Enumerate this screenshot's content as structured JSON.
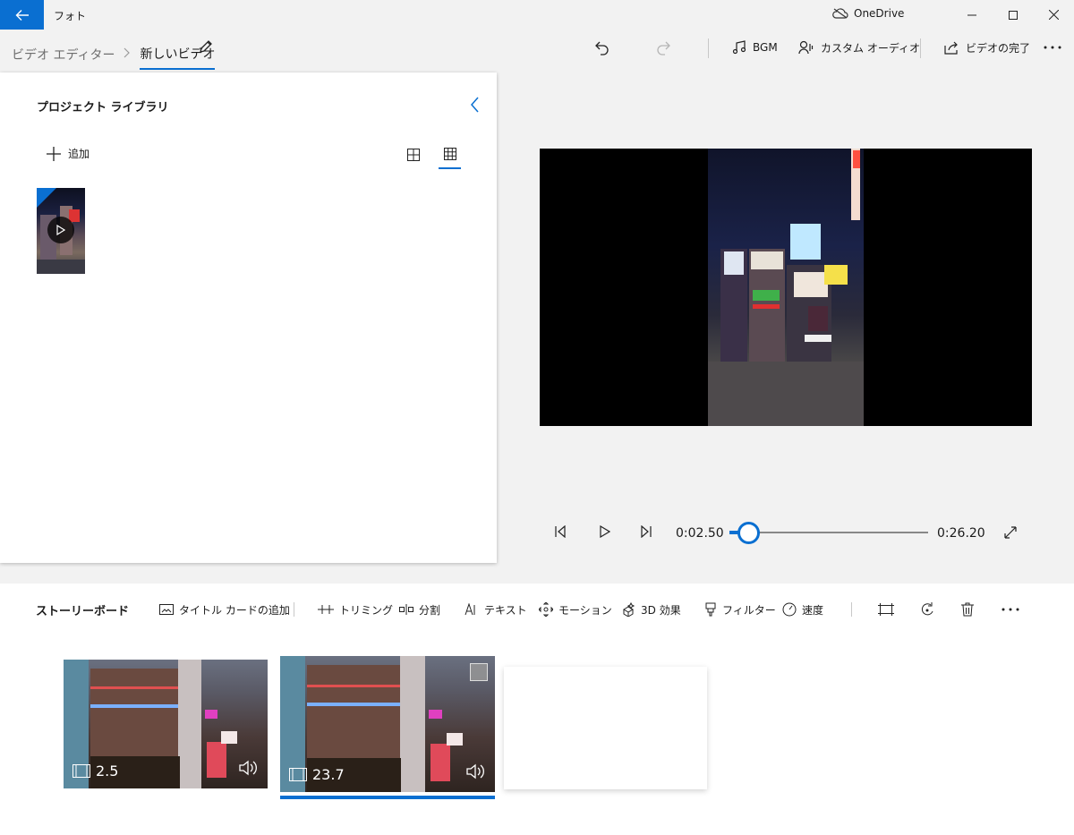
{
  "window": {
    "app_title": "フォト",
    "onedrive_label": "OneDrive"
  },
  "header": {
    "breadcrumb_parent": "ビデオ エディター",
    "breadcrumb_current": "新しいビデオ",
    "bgm_label": "BGM",
    "custom_audio_label": "カスタム オーディオ",
    "finish_label": "ビデオの完了"
  },
  "library": {
    "title": "プロジェクト ライブラリ",
    "add_label": "追加"
  },
  "playback": {
    "current_time": "0:02.50",
    "total_time": "0:26.20",
    "progress": 0.095
  },
  "storyboard": {
    "title": "ストーリーボード",
    "tools": {
      "title_card": "タイトル カードの追加",
      "trim": "トリミング",
      "split": "分割",
      "text": "テキスト",
      "motion": "モーション",
      "effects_3d": "3D 効果",
      "filter": "フィルター",
      "speed": "速度"
    },
    "clips": [
      {
        "duration": "2.5"
      },
      {
        "duration": "23.7"
      }
    ]
  },
  "colors": {
    "accent": "#0a6fd1",
    "panel": "#ffffff",
    "background": "#f2f2f2"
  }
}
